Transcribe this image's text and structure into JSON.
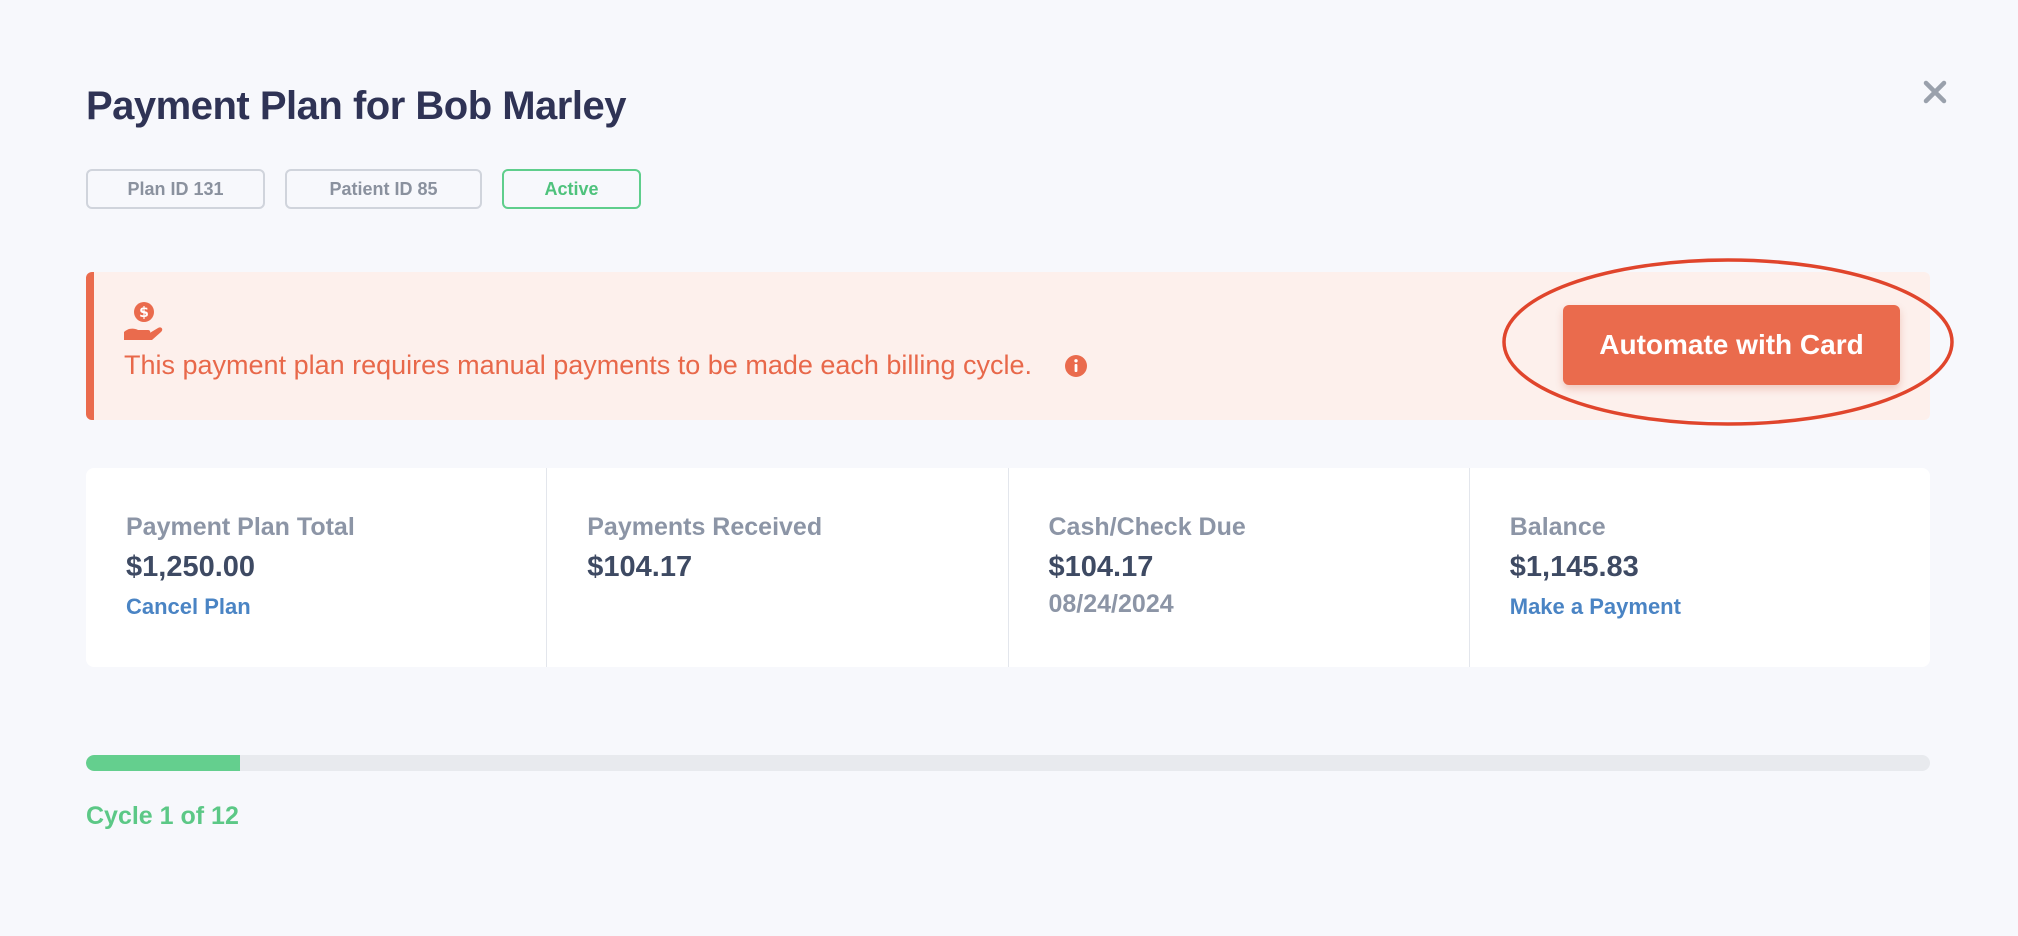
{
  "modal": {
    "title": "Payment Plan for Bob Marley"
  },
  "chips": {
    "plan_id": "Plan ID 131",
    "patient_id": "Patient ID 85",
    "status": "Active"
  },
  "alert": {
    "message": "This payment plan requires manual payments to be made each billing cycle.",
    "button_label": "Automate with Card",
    "icons": [
      "hand-coin-icon",
      "info-icon"
    ]
  },
  "stats": {
    "total": {
      "label": "Payment Plan Total",
      "value": "$1,250.00",
      "link": "Cancel Plan"
    },
    "received": {
      "label": "Payments Received",
      "value": "$104.17"
    },
    "due": {
      "label": "Cash/Check Due",
      "value": "$104.17",
      "date": "08/24/2024"
    },
    "balance": {
      "label": "Balance",
      "value": "$1,145.83",
      "link": "Make a Payment"
    }
  },
  "progress": {
    "fraction": 0.0833,
    "label": "Cycle 1 of 12"
  },
  "colors": {
    "accent": "#ea6b4d",
    "success": "#64cf8e",
    "link": "#4a84c4",
    "title": "#2f3355",
    "highlight_ring": "#e0452c"
  }
}
